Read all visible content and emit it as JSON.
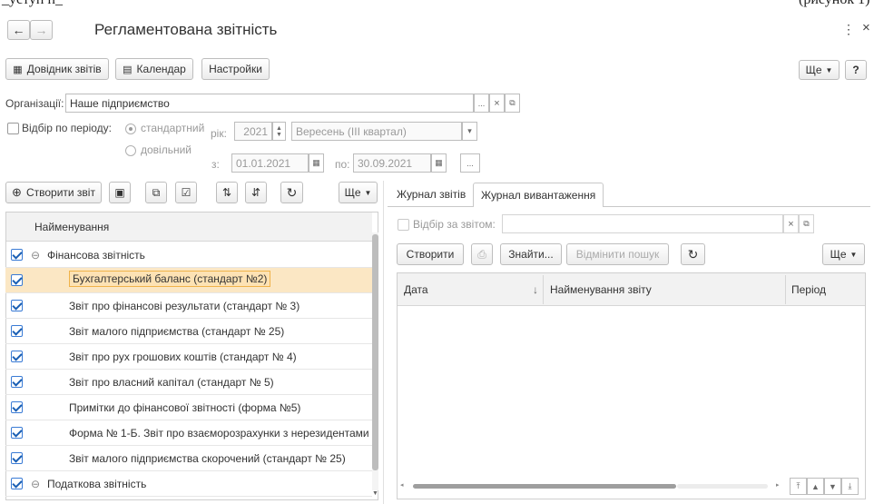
{
  "window": {
    "title": "Регламентована звітність",
    "menu_icon": "⋮",
    "close_icon": "×"
  },
  "toolbar": {
    "report_directory": "Довідник звітів",
    "calendar": "Календар",
    "settings": "Настройки",
    "more": "Ще",
    "help": "?"
  },
  "filters": {
    "org_label": "Організації:",
    "org_value": "Наше підприємство",
    "period_filter_label": "Відбір по періоду:",
    "standard_label": "стандартний",
    "custom_label": "довільний",
    "year_label": "рік:",
    "year_value": "2021",
    "period_value": "Вересень (III квартал)",
    "from_label": "з:",
    "from_value": "01.01.2021",
    "to_label": "по:",
    "to_value": "30.09.2021"
  },
  "left_toolbar": {
    "create_report": "Створити звіт",
    "more": "Ще"
  },
  "reports_table": {
    "header": "Найменування",
    "rows": [
      {
        "label": "Фінансова звітність",
        "group": true,
        "checked": true
      },
      {
        "label": "Бухгалтерський баланс (стандарт №2)",
        "group": false,
        "checked": true,
        "selected": true
      },
      {
        "label": "Звіт про фінансові результати (стандарт № 3)",
        "group": false,
        "checked": true
      },
      {
        "label": "Звіт малого підприємства (стандарт № 25)",
        "group": false,
        "checked": true
      },
      {
        "label": "Звіт про рух грошових коштів (стандарт № 4)",
        "group": false,
        "checked": true
      },
      {
        "label": "Звіт про власний капітал (стандарт № 5)",
        "group": false,
        "checked": true
      },
      {
        "label": "Примітки до фінансової звітності (форма №5)",
        "group": false,
        "checked": true
      },
      {
        "label": "Форма № 1-Б. Звіт про взаєморозрахунки з нерезидентами",
        "group": false,
        "checked": true
      },
      {
        "label": "Звіт малого підприємства скорочений (стандарт № 25)",
        "group": false,
        "checked": true
      },
      {
        "label": "Податкова звітність",
        "group": true,
        "checked": true
      }
    ]
  },
  "right_panel": {
    "tabs": [
      "Журнал звітів",
      "Журнал вивантаження"
    ],
    "active_tab": 1,
    "filter_label": "Відбір за звітом:",
    "create": "Створити",
    "find": "Знайти...",
    "cancel_search": "Відмінити пошук",
    "more": "Ще",
    "columns": [
      "Дата",
      "Найменування звіту",
      "Період"
    ],
    "sort_arrow": "↓"
  },
  "top_fragment": {
    "left": "_уступ п_",
    "right": "(рисунок 1)"
  }
}
